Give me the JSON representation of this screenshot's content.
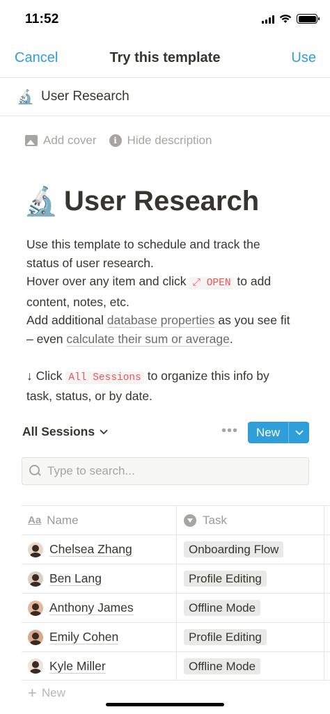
{
  "status_bar": {
    "time": "11:52"
  },
  "nav": {
    "cancel": "Cancel",
    "title": "Try this template",
    "use": "Use"
  },
  "page_row": {
    "icon": "🔬",
    "title": "User Research"
  },
  "controls": {
    "add_cover": "Add cover",
    "hide_description": "Hide description"
  },
  "page": {
    "icon": "🔬",
    "title": "User Research",
    "desc_1": "Use this template to schedule and track the",
    "desc_2": "status of user research.",
    "desc_3a": "Hover over any item and click",
    "desc_3code": "⤢ OPEN",
    "desc_3b": "to add",
    "desc_4": "content, notes, etc.",
    "desc_5a": "Add additional",
    "desc_5link": "database properties",
    "desc_5b": "as you see fit",
    "desc_6a": "– even",
    "desc_6link": "calculate their sum or average",
    "desc_6b": ".",
    "desc_7a": "↓ Click",
    "desc_7code": "All Sessions",
    "desc_7b": "to organize this info by",
    "desc_8": "task, status, or by date."
  },
  "database": {
    "view_label": "All Sessions",
    "more": "•••",
    "new_label": "New",
    "search_placeholder": "Type to search...",
    "columns": {
      "name": "Name",
      "task": "Task"
    },
    "rows": [
      {
        "name": "Chelsea Zhang",
        "task": "Onboarding Flow"
      },
      {
        "name": "Ben Lang",
        "task": "Profile Editing"
      },
      {
        "name": "Anthony James",
        "task": "Offline Mode"
      },
      {
        "name": "Emily Cohen",
        "task": "Profile Editing"
      },
      {
        "name": "Kyle Miller",
        "task": "Offline Mode"
      }
    ],
    "add_new": "New"
  },
  "colors": {
    "accent": "#2e9fd8",
    "text": "#37352f",
    "muted": "#a6a5a1",
    "code": "#eb5757"
  }
}
